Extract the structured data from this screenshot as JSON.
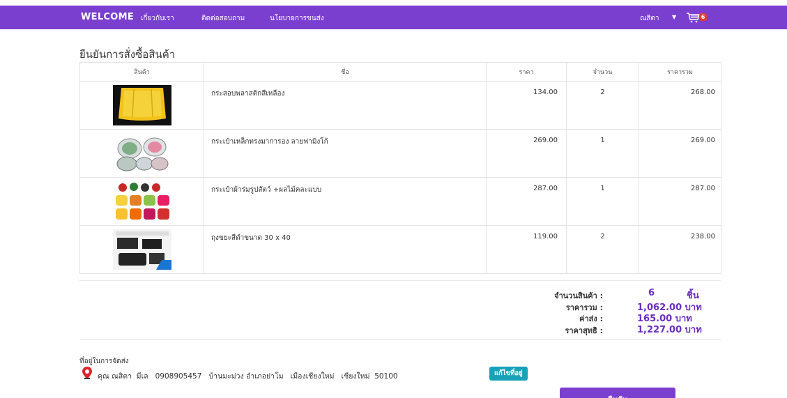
{
  "nav": {
    "brand": "WELCOME",
    "links": [
      "เกี่ยวกับเรา",
      "ติดต่อสอบถาม",
      "นโยบายการขนส่ง"
    ],
    "user": "ณสิตา",
    "cart_count": "6",
    "bg_color": "#7b3fd0",
    "badge_color": "#e53935"
  },
  "page": {
    "title": "ยืนยันการสั่งซื้อสินค้า"
  },
  "table": {
    "headers": [
      "สินค้า",
      "ชื่อ",
      "ราคา",
      "จำนวน",
      "ราคารวม"
    ],
    "rows": [
      {
        "image": "yellow-plastic-bag",
        "name": "กระสอบพลาสติกสีเหลือง",
        "price": "134.00",
        "qty": "2",
        "total": "268.00"
      },
      {
        "image": "tin-box-set",
        "name": "กระเป๋าเหล็กทรงมาการอง ลายฟามิงโก้",
        "price": "269.00",
        "qty": "1",
        "total": "269.00"
      },
      {
        "image": "fruit-animal-bags",
        "name": "กระเป๋าผ้าร่มรูปสัตว์ +ผลไม้คละแบบ",
        "price": "287.00",
        "qty": "1",
        "total": "287.00"
      },
      {
        "image": "black-garbage-bags",
        "name": "ถุงขยะสีดำขนาด 30 x 40",
        "price": "119.00",
        "qty": "2",
        "total": "238.00"
      }
    ]
  },
  "summary": {
    "count_label": "จำนวนสินค้า :",
    "count_value": "6",
    "count_unit": "ชิ้น",
    "subtotal_label": "ราคารวม :",
    "subtotal_value": "1,062.00 บาท",
    "shipping_label": "ค่าส่ง :",
    "shipping_value": "165.00 บาท",
    "net_label": "ราคาสุทธิ :",
    "net_value": "1,227.00 บาท",
    "accent_color": "#6a2dc1"
  },
  "address": {
    "title": "ที่อยู่ในการจัดส่ง",
    "text": "คุณ ณสิตา  มีเล   0908905457   บ้านมะม่วง อำเภอย่าโม   เมืองเชียงใหม่   เชียงใหม่  50100",
    "edit_label": "แก้ไขที่อยู่",
    "pin_icon": "map-pin-icon"
  },
  "actions": {
    "confirm_label": "ยืนยัน"
  }
}
